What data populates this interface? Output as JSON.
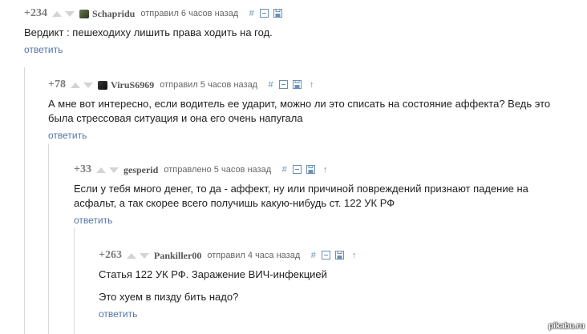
{
  "comments": [
    {
      "rating": "+234",
      "author": "Schapridu",
      "meta": "отправил 6 часов назад",
      "text": [
        "Вердикт : пешеходиху лишить права ходить на год."
      ],
      "reply_label": "ответить",
      "tools": [
        "hash-icon",
        "collapse-icon",
        "save-icon"
      ]
    },
    {
      "rating": "+78",
      "author": "ViruS6969",
      "meta": "отправил 5 часов назад",
      "text": [
        "А мне вот интересно, если водитель ее ударит, можно ли это списать на состояние аффекта? Ведь это была стрессовая ситуация и она его очень напугала"
      ],
      "reply_label": "ответить",
      "tools": [
        "hash-icon",
        "collapse-icon",
        "save-icon",
        "arrow-up-icon"
      ]
    },
    {
      "rating": "+33",
      "author": "gesperid",
      "meta": "отправлено 5 часов назад",
      "text": [
        "Если у тебя много денег, то да - аффект, ну или причиной повреждений признают падение на асфальт, а так скорее всего получишь какую-нибудь ст. 122 УК РФ"
      ],
      "reply_label": "ответить",
      "tools": [
        "hash-icon",
        "collapse-icon",
        "save-icon",
        "arrow-up-icon"
      ]
    },
    {
      "rating": "+263",
      "author": "Pankiller00",
      "meta": "отправил 4 часа назад",
      "text": [
        "Статья 122 УК РФ. Заражение ВИЧ-инфекцией",
        "Это хуем в пизду бить надо?"
      ],
      "reply_label": "ответить",
      "tools": [
        "hash-icon",
        "collapse-icon",
        "save-icon",
        "arrow-up-icon"
      ]
    }
  ],
  "watermark": "pikabu.ru",
  "colors": {
    "link": "#5276a8",
    "tool": "#6b8fb5",
    "vote": "#d4d4d4",
    "thread_line": "#d9d9d9"
  }
}
